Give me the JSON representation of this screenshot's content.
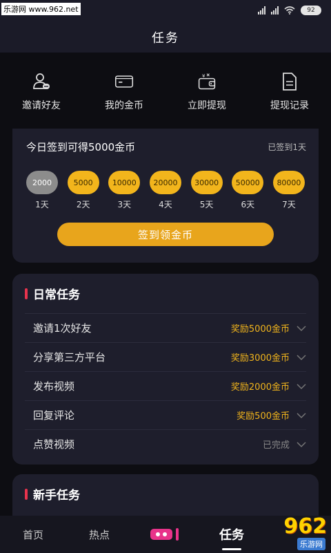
{
  "status": {
    "watermark": "乐游网 www.962.net",
    "net1": "HD",
    "net2": "HD",
    "battery": "92"
  },
  "header": {
    "title": "任务"
  },
  "quick_actions": [
    {
      "label": "邀请好友",
      "icon": "user-add-icon"
    },
    {
      "label": "我的金币",
      "icon": "wallet-icon"
    },
    {
      "label": "立即提现",
      "icon": "withdraw-wallet-icon"
    },
    {
      "label": "提现记录",
      "icon": "document-icon"
    }
  ],
  "signin": {
    "title": "今日签到可得5000金币",
    "status": "已签到1天",
    "days": [
      {
        "amount": "2000",
        "day": "1天",
        "done": true
      },
      {
        "amount": "5000",
        "day": "2天",
        "done": false
      },
      {
        "amount": "10000",
        "day": "3天",
        "done": false
      },
      {
        "amount": "20000",
        "day": "4天",
        "done": false
      },
      {
        "amount": "30000",
        "day": "5天",
        "done": false
      },
      {
        "amount": "50000",
        "day": "6天",
        "done": false
      },
      {
        "amount": "80000",
        "day": "7天",
        "done": false
      }
    ],
    "button_label": "签到领金币"
  },
  "daily_tasks": {
    "title": "日常任务",
    "items": [
      {
        "name": "邀请1次好友",
        "reward": "奖励5000金币",
        "completed": false
      },
      {
        "name": "分享第三方平台",
        "reward": "奖励3000金币",
        "completed": false
      },
      {
        "name": "发布视频",
        "reward": "奖励2000金币",
        "completed": false
      },
      {
        "name": "回复评论",
        "reward": "奖励500金币",
        "completed": false
      },
      {
        "name": "点赞视频",
        "reward": "已完成",
        "completed": true
      }
    ]
  },
  "newbie_tasks": {
    "title": "新手任务"
  },
  "tabbar": {
    "home": "首页",
    "hot": "热点",
    "task": "任务"
  },
  "watermark_br": {
    "brand": "962",
    "sub": "乐游网"
  },
  "colors": {
    "accent_gold": "#f2b51c",
    "button_gold": "#e8a51c",
    "section_bar": "#e8334d",
    "card_bg": "#1e1e2c"
  }
}
